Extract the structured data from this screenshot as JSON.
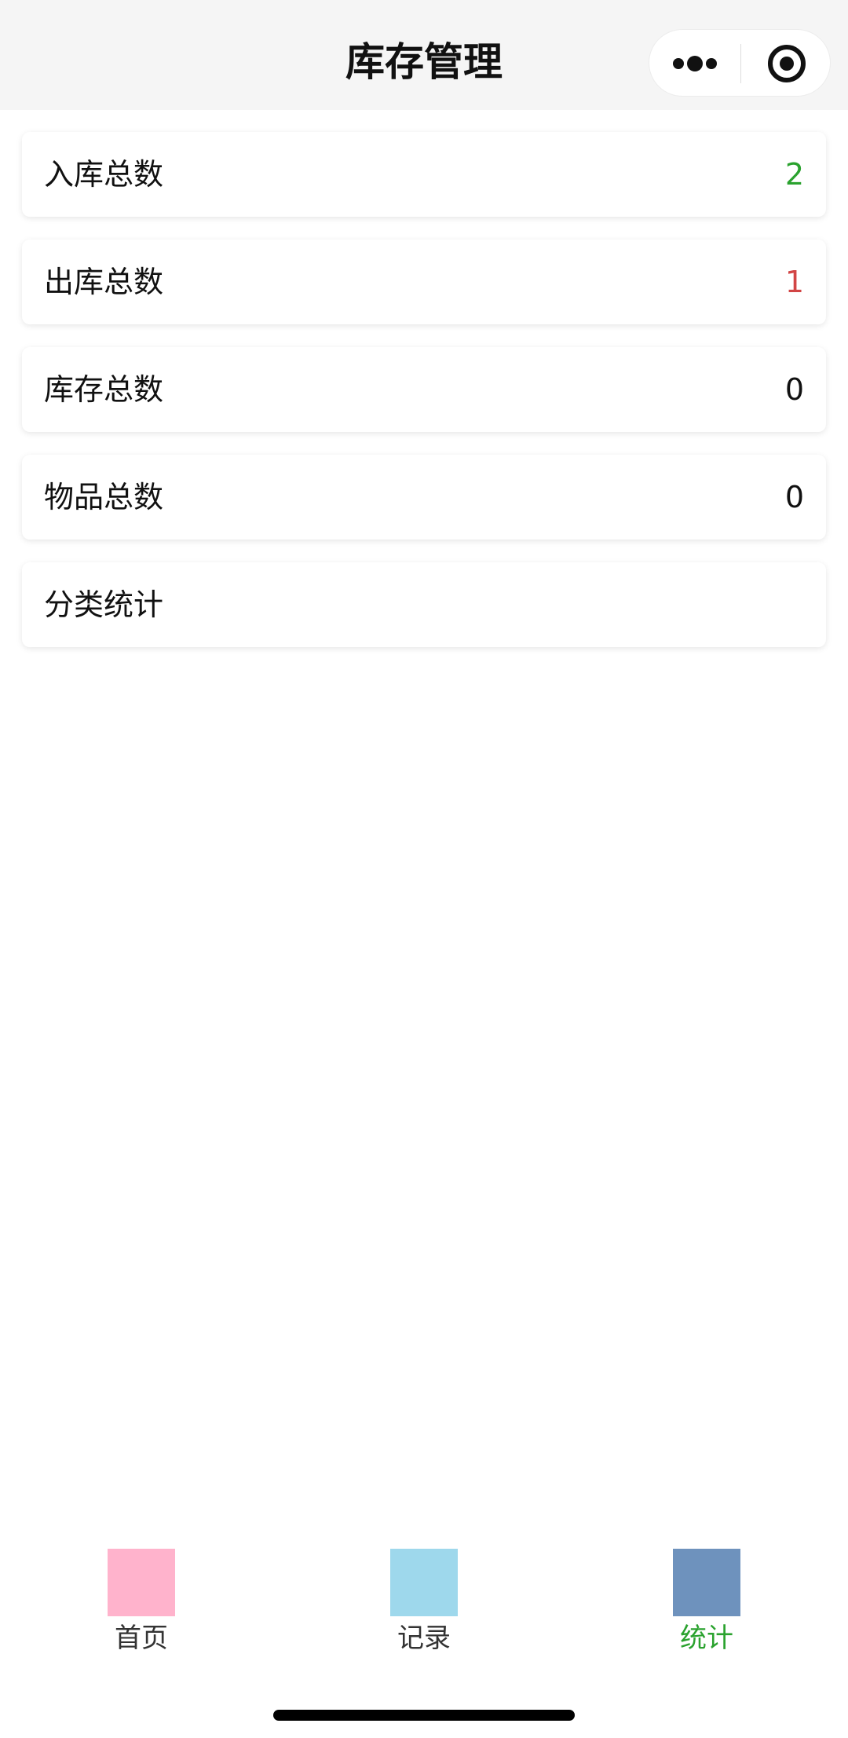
{
  "header": {
    "title": "库存管理",
    "more_icon": "more-dots-icon",
    "close_icon": "target-circle-icon"
  },
  "stats": [
    {
      "label": "入库总数",
      "value": "2",
      "color": "#2aa22e"
    },
    {
      "label": "出库总数",
      "value": "1",
      "color": "#d24545"
    },
    {
      "label": "库存总数",
      "value": "0",
      "color": "#111111"
    },
    {
      "label": "物品总数",
      "value": "0",
      "color": "#111111"
    },
    {
      "label": "分类统计",
      "value": ""
    }
  ],
  "tabbar": {
    "items": [
      {
        "label": "首页",
        "icon_color": "#ffb3cc",
        "active": false
      },
      {
        "label": "记录",
        "icon_color": "#9ed8ec",
        "active": false
      },
      {
        "label": "统计",
        "icon_color": "#6e92bd",
        "active": true
      }
    ],
    "active_color": "#2aa22e"
  }
}
